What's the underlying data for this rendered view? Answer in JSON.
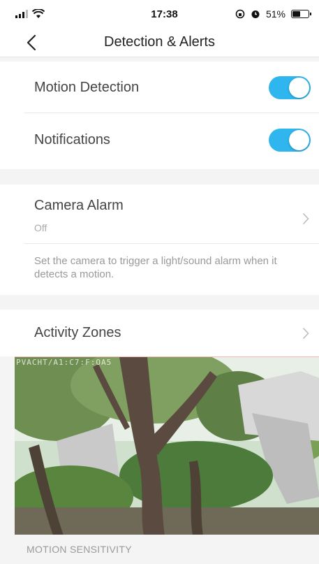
{
  "status_bar": {
    "time": "17:38",
    "battery_text": "51%",
    "battery_level": 0.51
  },
  "nav": {
    "title": "Detection & Alerts"
  },
  "settings": {
    "motion_detection": {
      "label": "Motion Detection",
      "enabled": true
    },
    "notifications": {
      "label": "Notifications",
      "enabled": true
    },
    "camera_alarm": {
      "label": "Camera Alarm",
      "value": "Off",
      "description": "Set the camera to trigger a light/sound alarm when it detects a motion."
    },
    "activity_zones": {
      "label": "Activity Zones"
    }
  },
  "camera_feed": {
    "overlay_text": "PVACHT/A1:C7:F:OA5"
  },
  "motion_sensitivity": {
    "header": "MOTION SENSITIVITY"
  },
  "colors": {
    "accent": "#2fb6ee",
    "background": "#f4f4f5",
    "zone_border": "#f3b9b9"
  }
}
